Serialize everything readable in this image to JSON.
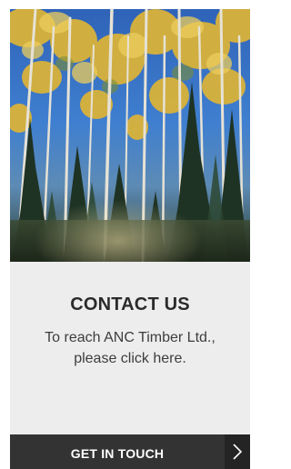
{
  "card": {
    "image": {
      "alt": "Aspen and pine forest with golden leaves against a blue sky",
      "description_icon": "forest-photo"
    },
    "title": "CONTACT US",
    "description": "To reach ANC Timber Ltd., please click here.",
    "cta": {
      "label": "GET IN TOUCH",
      "icon": "chevron-right-icon"
    }
  },
  "colors": {
    "card_background": "#ededed",
    "cta_background": "#333333",
    "cta_arrow_background": "#242424",
    "title_text": "#2b2b2b",
    "body_text": "#3d3d3d",
    "cta_text": "#ffffff"
  }
}
